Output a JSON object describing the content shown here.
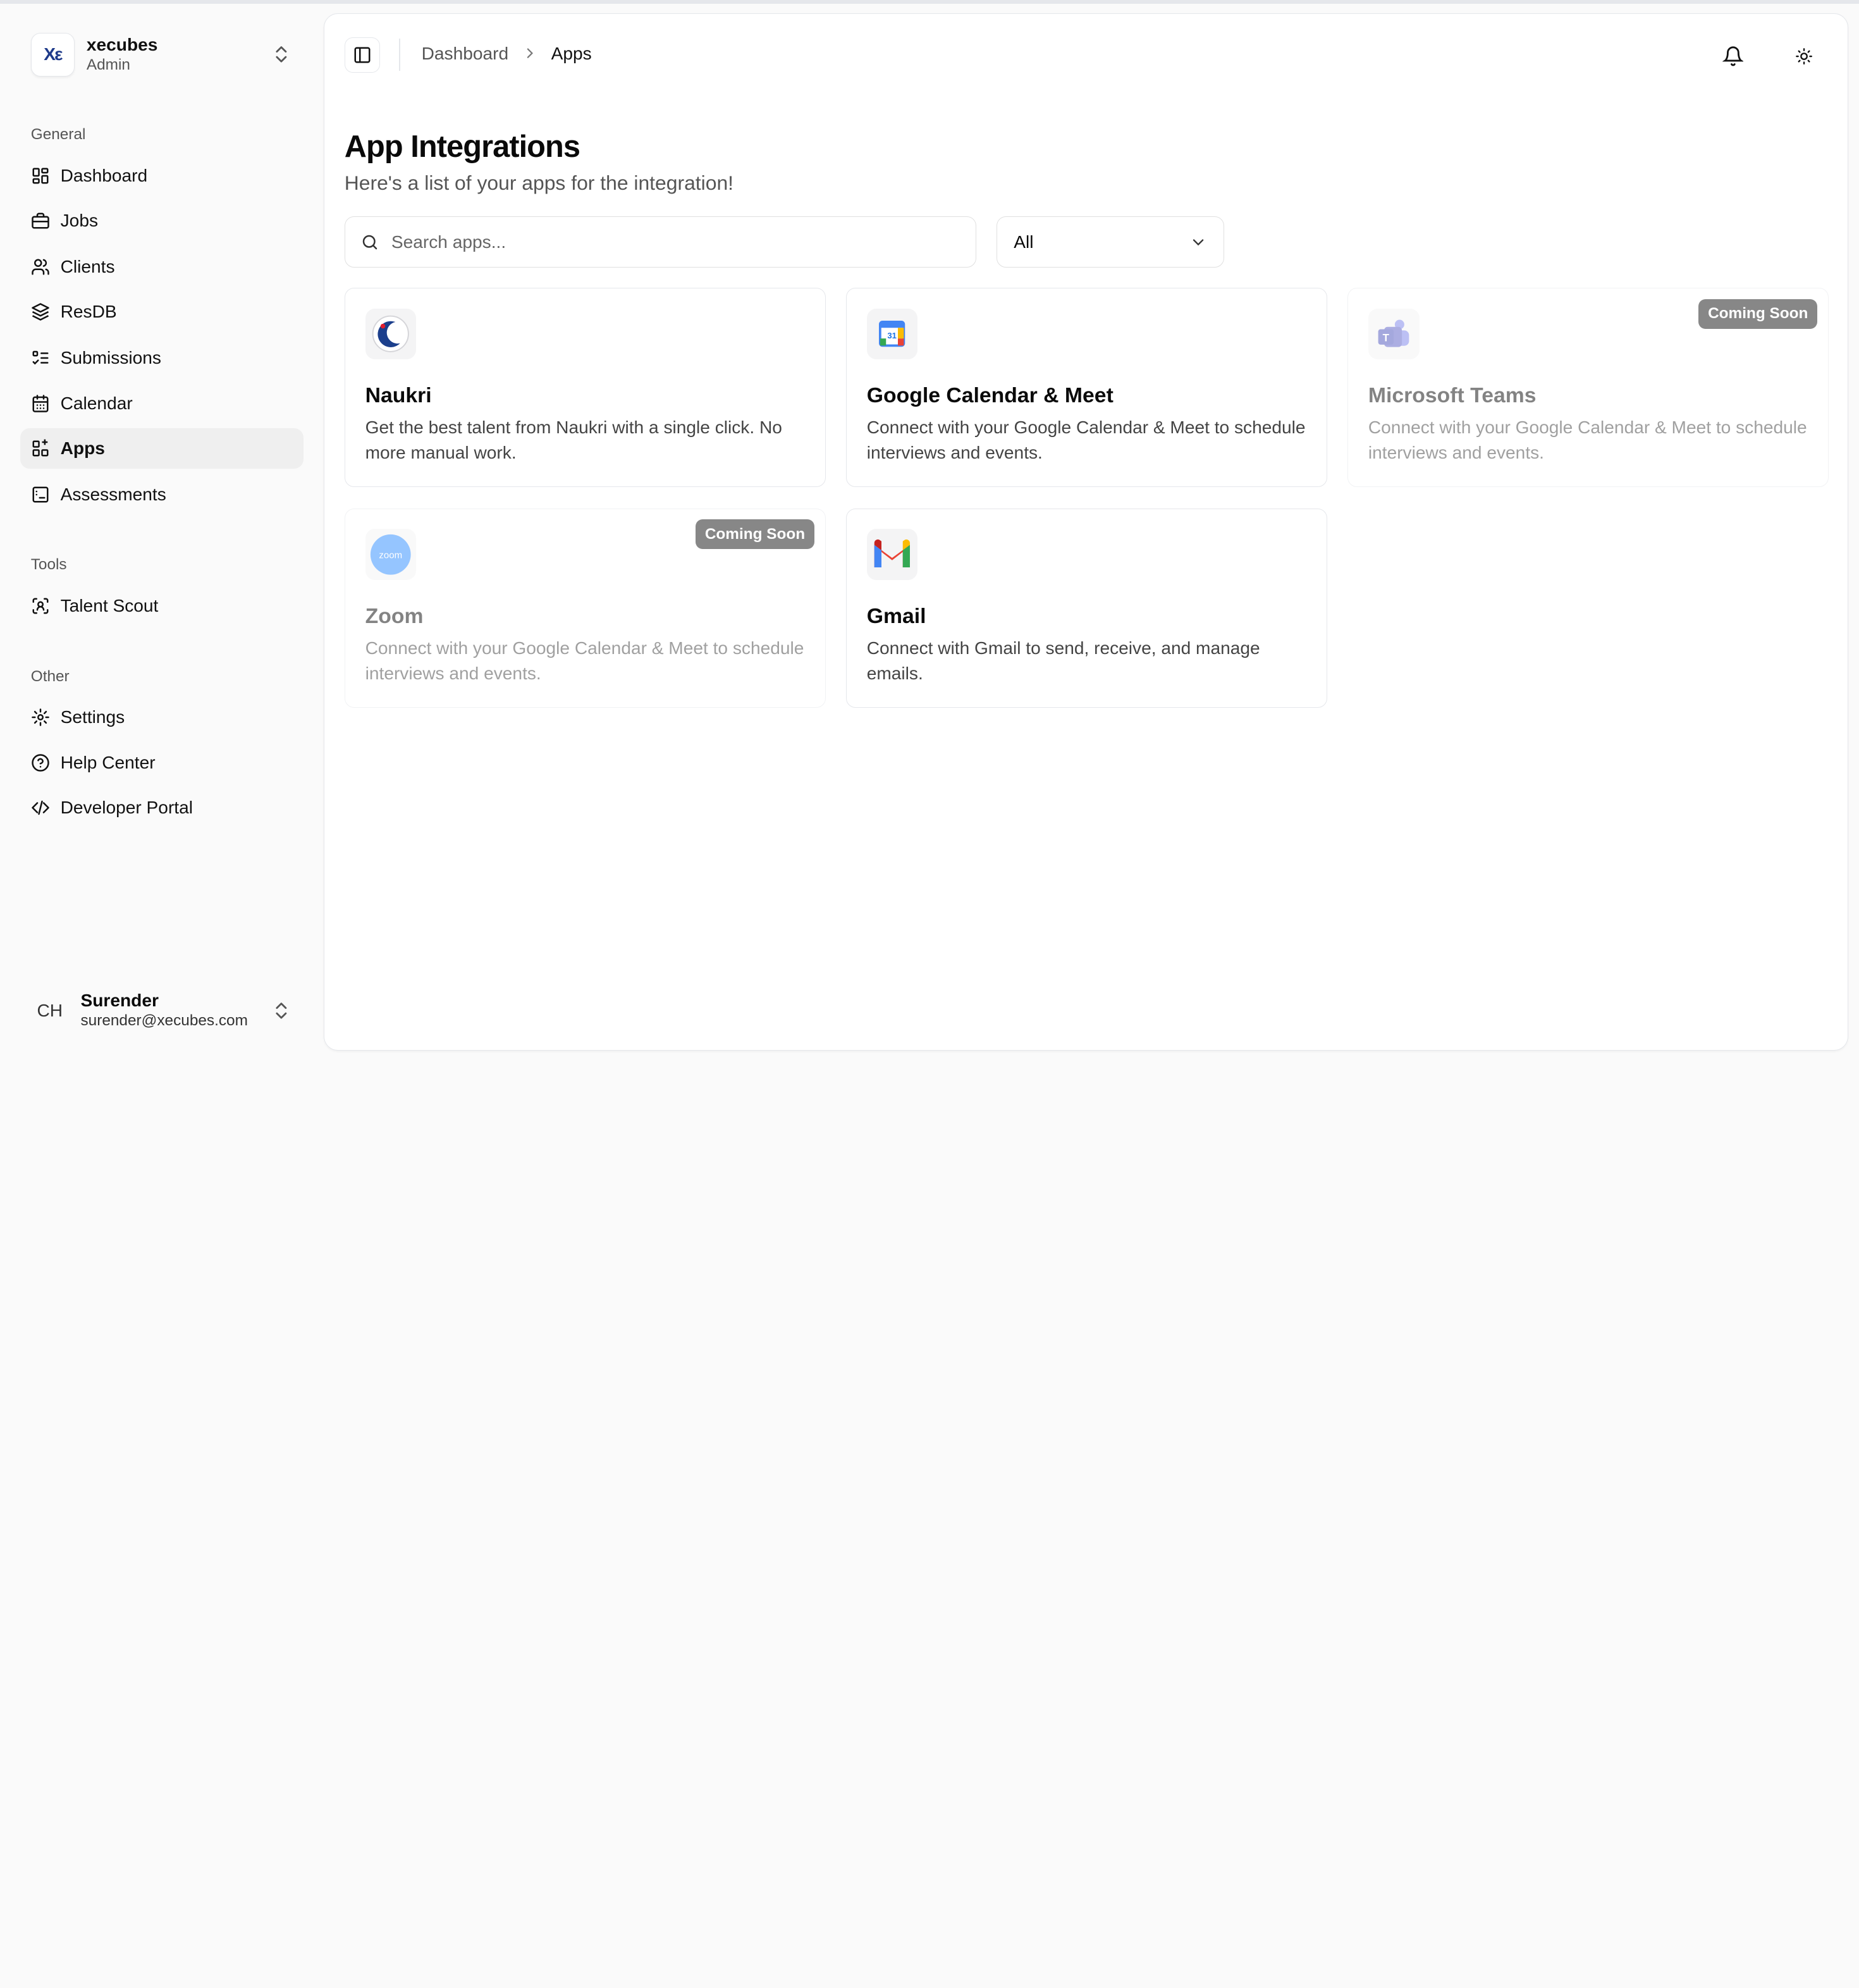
{
  "team": {
    "logo_text": "Xε",
    "name": "xecubes",
    "role": "Admin"
  },
  "nav": {
    "general_label": "General",
    "general": [
      {
        "label": "Dashboard",
        "icon": "layout-dashboard-icon"
      },
      {
        "label": "Jobs",
        "icon": "briefcase-icon"
      },
      {
        "label": "Clients",
        "icon": "users-icon"
      },
      {
        "label": "ResDB",
        "icon": "layers-icon"
      },
      {
        "label": "Submissions",
        "icon": "list-checks-icon"
      },
      {
        "label": "Calendar",
        "icon": "calendar-icon"
      },
      {
        "label": "Apps",
        "icon": "apps-grid-icon",
        "active": true
      },
      {
        "label": "Assessments",
        "icon": "assessment-icon"
      }
    ],
    "tools_label": "Tools",
    "tools": [
      {
        "label": "Talent Scout",
        "icon": "scan-user-icon"
      }
    ],
    "other_label": "Other",
    "other": [
      {
        "label": "Settings",
        "icon": "gear-icon"
      },
      {
        "label": "Help Center",
        "icon": "help-circle-icon"
      },
      {
        "label": "Developer Portal",
        "icon": "code-icon"
      }
    ]
  },
  "user": {
    "initials": "CH",
    "name": "Surender",
    "email": "surender@xecubes.com"
  },
  "header": {
    "breadcrumb": {
      "parent": "Dashboard",
      "current": "Apps"
    }
  },
  "page": {
    "title": "App Integrations",
    "subtitle": "Here's a list of your apps for the integration!"
  },
  "search": {
    "placeholder": "Search apps...",
    "value": ""
  },
  "filter": {
    "selected": "All"
  },
  "apps": [
    {
      "name": "Naukri",
      "description": "Get the best talent from Naukri with a single click. No more manual work.",
      "icon": "naukri-logo-icon",
      "coming_soon": false
    },
    {
      "name": "Google Calendar & Meet",
      "description": "Connect with your Google Calendar & Meet to schedule interviews and events.",
      "icon": "google-calendar-icon",
      "coming_soon": false
    },
    {
      "name": "Microsoft Teams",
      "description": "Connect with your Google Calendar & Meet to schedule interviews and events.",
      "icon": "microsoft-teams-icon",
      "coming_soon": true,
      "badge": "Coming Soon"
    },
    {
      "name": "Zoom",
      "description": "Connect with your Google Calendar & Meet to schedule interviews and events.",
      "icon": "zoom-logo-icon",
      "coming_soon": true,
      "badge": "Coming Soon",
      "logo_text": "zoom"
    },
    {
      "name": "Gmail",
      "description": "Connect with Gmail to send, receive, and manage emails.",
      "icon": "gmail-logo-icon",
      "coming_soon": false
    }
  ],
  "colors": {
    "badge_bg": "#111111",
    "active_nav_bg": "#efefef",
    "zoom_blue": "#2d8cff",
    "teams_purple": "#5b5fc7"
  }
}
